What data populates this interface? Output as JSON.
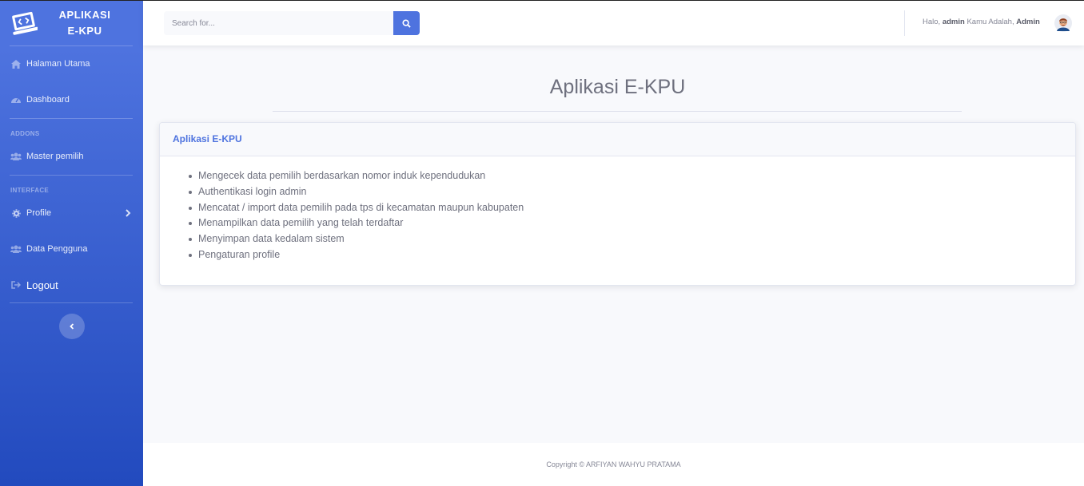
{
  "brand": {
    "line1": "APLIKASI",
    "line2": "E-KPU",
    "icon": "laptop-code-icon"
  },
  "sidebar": {
    "items": [
      {
        "label": "Halaman Utama",
        "icon": "home-icon"
      },
      {
        "label": "Dashboard",
        "icon": "dashboard-icon"
      },
      {
        "label": "Master pemilih",
        "icon": "users-icon"
      },
      {
        "label": "Profile",
        "icon": "gear-icon"
      },
      {
        "label": "Data Pengguna",
        "icon": "users-icon"
      },
      {
        "label": "Logout",
        "icon": "sign-out-icon"
      }
    ],
    "headings": {
      "addons": "ADDONS",
      "interface": "INTERFACE"
    }
  },
  "topbar": {
    "search_placeholder": "Search for...",
    "greeting": {
      "prefix": "Halo,",
      "user": "admin",
      "middle": "Kamu Adalah,",
      "role": "Admin"
    }
  },
  "main": {
    "title": "Aplikasi E-KPU",
    "card": {
      "title": "Aplikasi E-KPU",
      "items": [
        "Mengecek data pemilih berdasarkan nomor induk kependudukan",
        "Authentikasi login admin",
        "Mencatat / import data pemilih pada tps di kecamatan maupun kabupaten",
        "Menampilkan data pemilih yang telah terdaftar",
        "Menyimpan data kedalam sistem",
        "Pengaturan profile"
      ]
    }
  },
  "footer": {
    "text": "Copyright © ARFIYAN WAHYU PRATAMA"
  },
  "colors": {
    "primary": "#4e73df",
    "primary_dark": "#224abe",
    "text": "#6e707e",
    "background": "#f8f9fc"
  }
}
